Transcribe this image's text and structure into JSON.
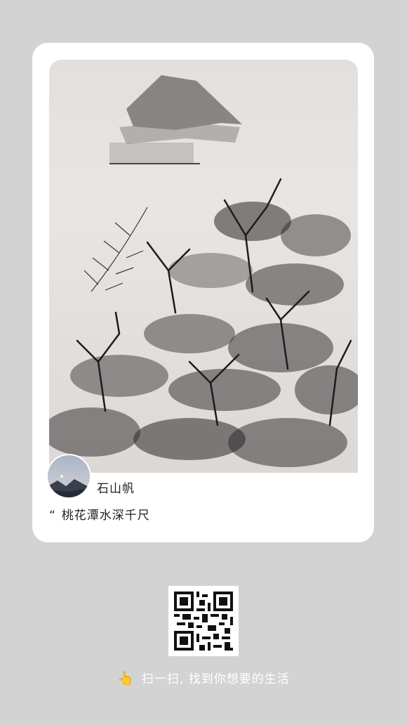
{
  "card": {
    "painting_alt": "ink-wash landscape painting",
    "author_name": "石山帆",
    "quote_mark": "“",
    "quote_text": "桃花潭水深千尺"
  },
  "footer": {
    "hand_icon": "pointing-hand-icon",
    "scan_text": "扫一扫, 找到你想要的生活"
  },
  "colors": {
    "background": "#d3d3d3",
    "card": "#ffffff",
    "ink": "#2a2627"
  }
}
